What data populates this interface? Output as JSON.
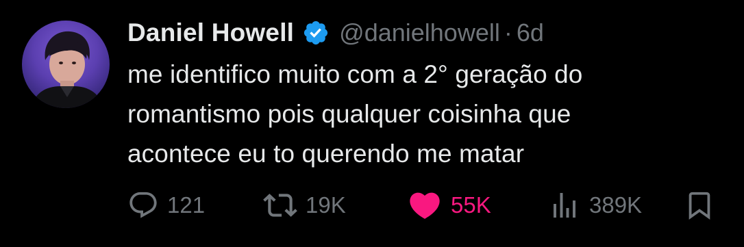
{
  "user": {
    "display_name": "Daniel Howell",
    "handle": "@danielhowell",
    "separator": "·",
    "time": "6d",
    "verified": true,
    "verified_color": "#1d9bf0"
  },
  "tweet": {
    "lines": [
      "me identifico muito com a 2° geração do",
      "romantismo pois qualquer coisinha que",
      "acontece eu to querendo me matar"
    ]
  },
  "actions": {
    "reply": {
      "icon": "reply-icon",
      "count": "121"
    },
    "retweet": {
      "icon": "retweet-icon",
      "count": "19K"
    },
    "like": {
      "icon": "heart-icon",
      "count": "55K",
      "liked": true,
      "color": "#f91880"
    },
    "views": {
      "icon": "views-icon",
      "count": "389K"
    },
    "bookmark": {
      "icon": "bookmark-icon"
    }
  },
  "colors": {
    "background": "#000000",
    "text_primary": "#e7e9ea",
    "text_secondary": "#71767b"
  }
}
